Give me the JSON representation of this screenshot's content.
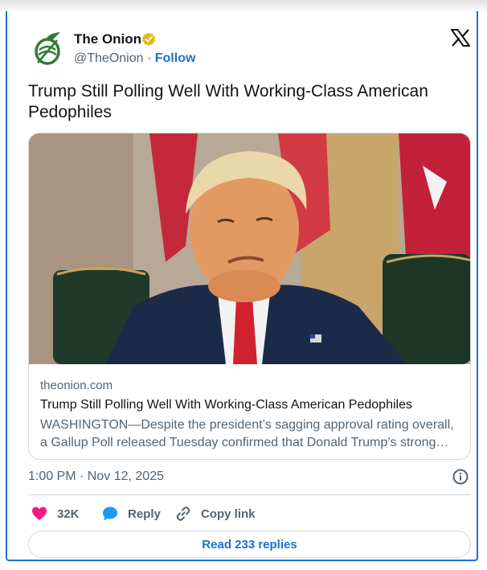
{
  "account": {
    "name": "The Onion",
    "handle": "@TheOnion",
    "separator": "·",
    "follow_label": "Follow"
  },
  "tweet": {
    "text": "Trump Still Polling Well With Working-Class American Pedophiles",
    "timestamp": "1:00 PM · Nov 12, 2025"
  },
  "link_card": {
    "domain": "theonion.com",
    "title": "Trump Still Polling Well With Working-Class American Pedophiles",
    "description": "WASHINGTON—Despite the president’s sagging approval rating overall, a Gallup Poll released Tuesday confirmed that Donald Trump’s strong support among working-class American pedophiles."
  },
  "actions": {
    "likes_count": "32K",
    "reply_label": "Reply",
    "copy_link_label": "Copy link"
  },
  "replies_button": "Read 233 replies",
  "icons": {
    "avatar": "onion-logo-icon",
    "verified": "verified-badge-icon",
    "brand": "x-logo-icon",
    "info": "info-icon",
    "like": "heart-icon",
    "reply": "speech-bubble-icon",
    "copy_link": "link-icon"
  },
  "colors": {
    "accent": "#1d6fd1",
    "like": "#f91880",
    "verified": "#e2b719",
    "onion_green": "#2e7d32"
  }
}
